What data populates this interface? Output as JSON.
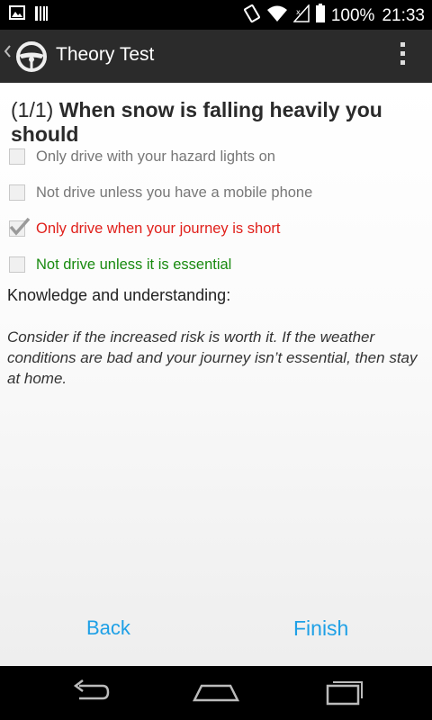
{
  "status_bar": {
    "battery": "100%",
    "time": "21:33"
  },
  "action_bar": {
    "title": "Theory Test"
  },
  "question": {
    "counter": "(1/1)",
    "text": "When snow is falling heavily you should"
  },
  "options": [
    {
      "label": "Only drive with your hazard lights on",
      "checked": false,
      "state": "neutral"
    },
    {
      "label": "Not drive unless you have a mobile phone",
      "checked": false,
      "state": "neutral"
    },
    {
      "label": "Only drive when your journey is short",
      "checked": true,
      "state": "wrong"
    },
    {
      "label": "Not drive unless it is essential",
      "checked": false,
      "state": "correct"
    }
  ],
  "knowledge": {
    "heading": "Knowledge and understanding:",
    "body": "Consider if the increased risk is worth it. If the weather conditions are bad and your journey isn’t essential, then stay at home."
  },
  "footer": {
    "back_label": "Back",
    "finish_label": "Finish"
  },
  "colors": {
    "accent": "#1ea0e6",
    "wrong": "#e0201b",
    "correct": "#188a0f"
  }
}
